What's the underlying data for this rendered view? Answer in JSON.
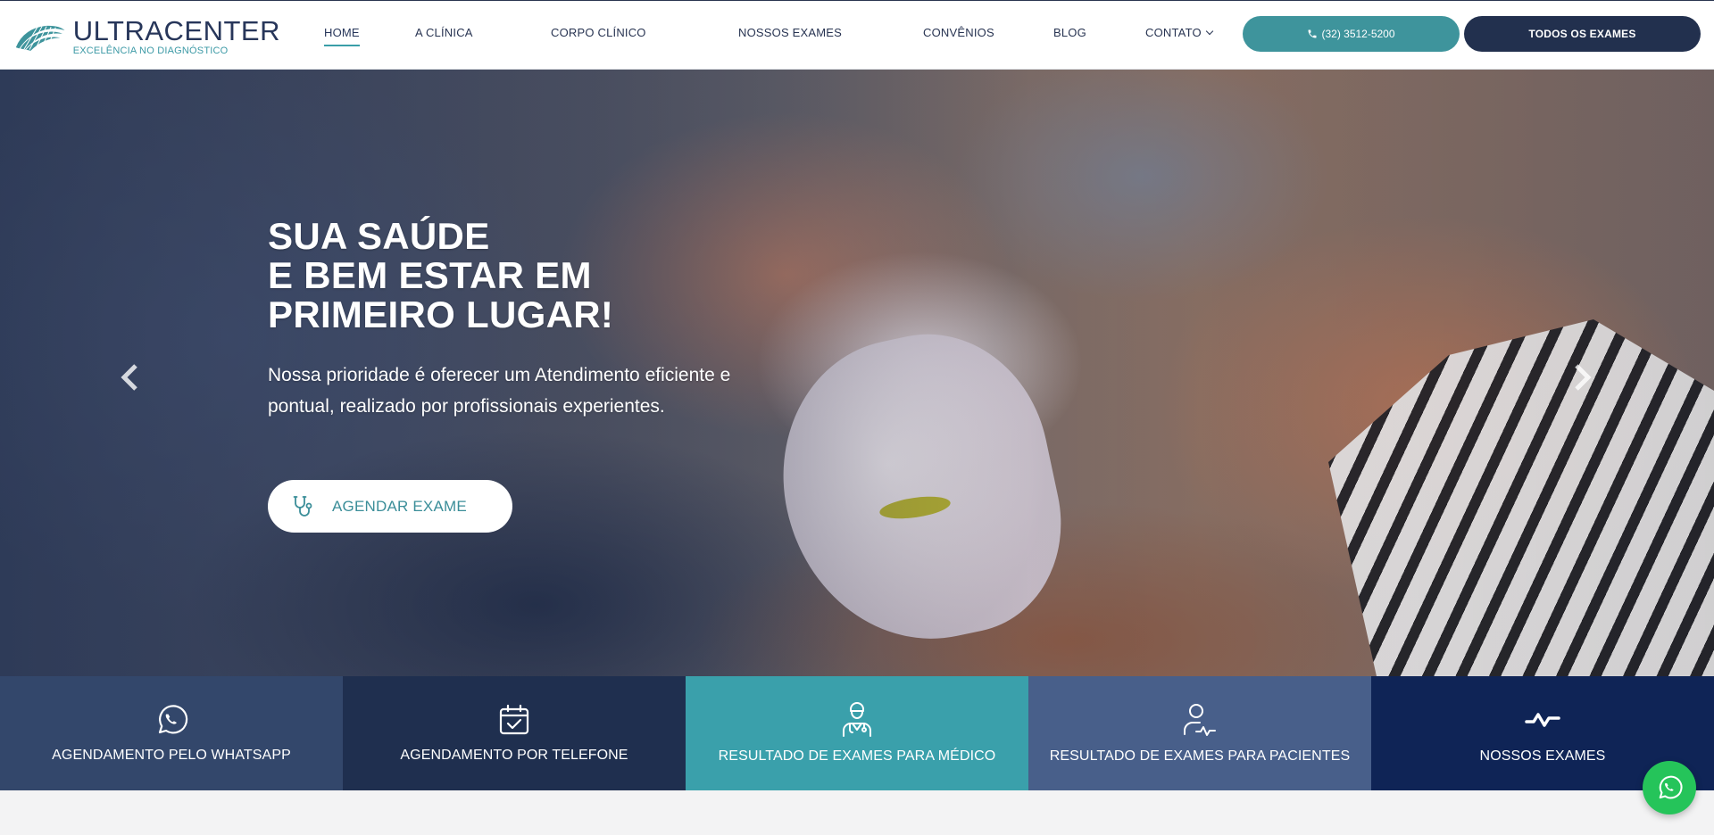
{
  "brand": {
    "name": "ULTRACENTER",
    "tagline": "EXCELÊNCIA NO DIAGNÓSTICO",
    "primary_color": "#27365a",
    "accent_color": "#3e949c"
  },
  "nav": {
    "items": [
      {
        "label": "HOME",
        "active": true
      },
      {
        "label": "A CLÍNICA"
      },
      {
        "label": "CORPO CLÍNICO"
      },
      {
        "label": "NOSSOS EXAMES"
      },
      {
        "label": "CONVÊNIOS"
      },
      {
        "label": "BLOG"
      },
      {
        "label": "CONTATO",
        "has_dropdown": true
      }
    ],
    "phone_button": {
      "label": "(32) 3512-5200",
      "icon": "phone-icon"
    },
    "exams_button": {
      "label": "TODOS OS EXAMES"
    }
  },
  "hero": {
    "title_lines": [
      "SUA SAÚDE",
      "E BEM ESTAR EM",
      "PRIMEIRO LUGAR!"
    ],
    "description": "Nossa prioridade é oferecer um Atendimento eficiente e pontual, realizado por profissionais experientes.",
    "cta": {
      "label": "AGENDAR EXAME",
      "icon": "stethoscope-icon"
    },
    "prev_icon": "chevron-left-icon",
    "next_icon": "chevron-right-icon"
  },
  "features": [
    {
      "label": "AGENDAMENTO PELO WHATSAPP",
      "icon": "whatsapp-icon",
      "color": "#33476b"
    },
    {
      "label": "AGENDAMENTO POR TELEFONE",
      "icon": "calendar-check-icon",
      "color": "#1f2f4f"
    },
    {
      "label": "RESULTADO DE EXAMES PARA MÉDICO",
      "icon": "doctor-icon",
      "color": "#3aa0ab"
    },
    {
      "label": "RESULTADO DE EXAMES PARA PACIENTES",
      "icon": "patient-pulse-icon",
      "color": "#485f8a"
    },
    {
      "label": "NOSSOS EXAMES",
      "icon": "pulse-icon",
      "color": "#0f2456"
    }
  ],
  "floating": {
    "icon": "whatsapp-icon",
    "color": "#25c45a"
  }
}
